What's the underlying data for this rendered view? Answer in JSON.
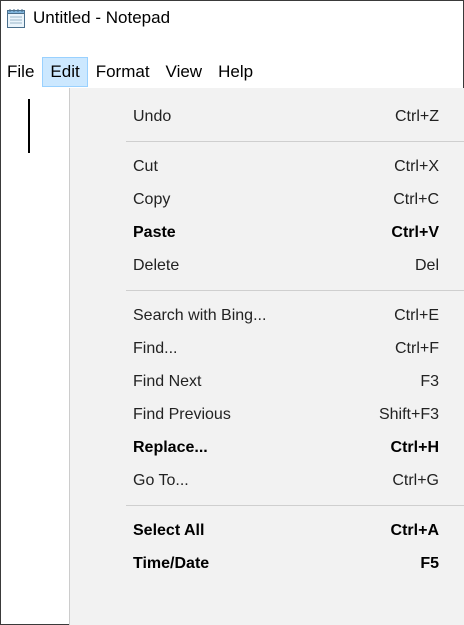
{
  "window": {
    "title": "Untitled - Notepad",
    "icon": "notepad-icon"
  },
  "menubar": {
    "items": [
      {
        "label": "File",
        "active": false
      },
      {
        "label": "Edit",
        "active": true
      },
      {
        "label": "Format",
        "active": false
      },
      {
        "label": "View",
        "active": false
      },
      {
        "label": "Help",
        "active": false
      }
    ]
  },
  "edit_menu": {
    "groups": [
      [
        {
          "label": "Undo",
          "shortcut": "Ctrl+Z",
          "enabled": true
        }
      ],
      [
        {
          "label": "Cut",
          "shortcut": "Ctrl+X",
          "enabled": true
        },
        {
          "label": "Copy",
          "shortcut": "Ctrl+C",
          "enabled": true
        },
        {
          "label": "Paste",
          "shortcut": "Ctrl+V",
          "enabled": true,
          "emphasis": true
        },
        {
          "label": "Delete",
          "shortcut": "Del",
          "enabled": true
        }
      ],
      [
        {
          "label": "Search with Bing...",
          "shortcut": "Ctrl+E",
          "enabled": true
        },
        {
          "label": "Find...",
          "shortcut": "Ctrl+F",
          "enabled": true
        },
        {
          "label": "Find Next",
          "shortcut": "F3",
          "enabled": true
        },
        {
          "label": "Find Previous",
          "shortcut": "Shift+F3",
          "enabled": true
        },
        {
          "label": "Replace...",
          "shortcut": "Ctrl+H",
          "enabled": true,
          "emphasis": true
        },
        {
          "label": "Go To...",
          "shortcut": "Ctrl+G",
          "enabled": true
        }
      ],
      [
        {
          "label": "Select All",
          "shortcut": "Ctrl+A",
          "enabled": true,
          "emphasis": true
        },
        {
          "label": "Time/Date",
          "shortcut": "F5",
          "enabled": true,
          "emphasis": true
        }
      ]
    ]
  },
  "colors": {
    "menu_highlight": "#cce8ff",
    "menu_highlight_border": "#99d1ff",
    "dropdown_bg": "#f2f2f2"
  }
}
